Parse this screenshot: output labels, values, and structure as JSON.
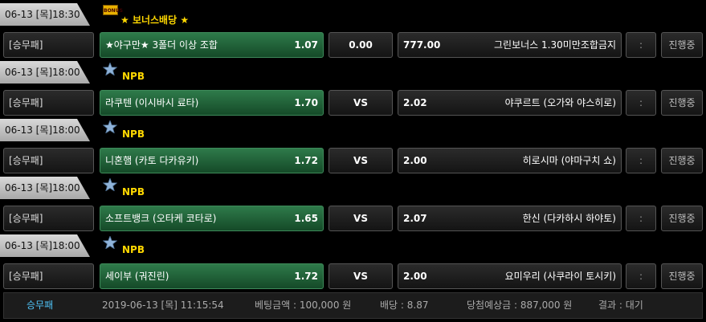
{
  "games": [
    {
      "date": "06-13 [목]18:30",
      "league": "보너스배당",
      "league_icon": "bonus-badge-icon",
      "badge_text": "BONUS",
      "bet_type": "[승무패]",
      "home": "★야구만★ 3폴더 이상 조합",
      "home_odds": "1.07",
      "draw": "0.00",
      "away_odds": "777.00",
      "away": "그린보너스 1.30미만조합금지",
      "more": ":",
      "status": "진행중"
    },
    {
      "date": "06-13 [목]18:00",
      "league": "NPB",
      "league_icon": "baseball-star-icon",
      "bet_type": "[승무패]",
      "home": "라쿠텐 (이시바시 료타)",
      "home_odds": "1.70",
      "draw": "VS",
      "away_odds": "2.02",
      "away": "야쿠르트 (오가와 야스히로)",
      "more": ":",
      "status": "진행중"
    },
    {
      "date": "06-13 [목]18:00",
      "league": "NPB",
      "league_icon": "baseball-star-icon",
      "bet_type": "[승무패]",
      "home": "니혼햄 (카토 다카유키)",
      "home_odds": "1.72",
      "draw": "VS",
      "away_odds": "2.00",
      "away": "히로시마 (야마구치 쇼)",
      "more": ":",
      "status": "진행중"
    },
    {
      "date": "06-13 [목]18:00",
      "league": "NPB",
      "league_icon": "baseball-star-icon",
      "bet_type": "[승무패]",
      "home": "소프트뱅크 (오타케 코타로)",
      "home_odds": "1.65",
      "draw": "VS",
      "away_odds": "2.07",
      "away": "한신 (다카하시 하야토)",
      "more": ":",
      "status": "진행중"
    },
    {
      "date": "06-13 [목]18:00",
      "league": "NPB",
      "league_icon": "baseball-star-icon",
      "bet_type": "[승무패]",
      "home": "세이부 (궈진린)",
      "home_odds": "1.72",
      "draw": "VS",
      "away_odds": "2.00",
      "away": "요미우리 (사쿠라이 토시키)",
      "more": ":",
      "status": "진행중"
    }
  ],
  "slip": {
    "type": "승무패",
    "datetime": "2019-06-13 [목] 11:15:54",
    "bet_amount": "베팅금액 : 100,000 원",
    "odds": "배당 : 8.87",
    "winnings": "당첨예상금 : 887,000 원",
    "result": "결과 : 대기"
  },
  "colors": {
    "accent_yellow": "#ffd800",
    "home_green": "#2e7a4a",
    "slip_type": "#4fc3f7"
  }
}
